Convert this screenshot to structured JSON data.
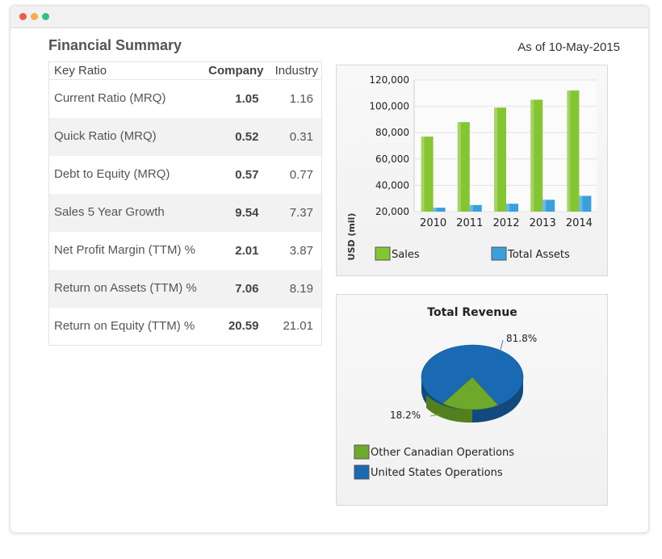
{
  "window": {
    "controls": [
      {
        "name": "close",
        "color": "#ee5a4a"
      },
      {
        "name": "minimize",
        "color": "#f4b03f"
      },
      {
        "name": "maximize",
        "color": "#2fc282"
      }
    ]
  },
  "summary": {
    "title": "Financial Summary",
    "as_of": "As of 10-May-2015"
  },
  "ratios": {
    "headers": {
      "key_ratio": "Key Ratio",
      "company": "Company",
      "industry": "Industry"
    },
    "rows": [
      {
        "name": "Current Ratio (MRQ)",
        "company": "1.05",
        "industry": "1.16"
      },
      {
        "name": "Quick Ratio (MRQ)",
        "company": "0.52",
        "industry": "0.31"
      },
      {
        "name": "Debt to Equity (MRQ)",
        "company": "0.57",
        "industry": "0.77"
      },
      {
        "name": "Sales 5 Year Growth",
        "company": "9.54",
        "industry": "7.37"
      },
      {
        "name": "Net Profit Margin (TTM) %",
        "company": "2.01",
        "industry": "3.87"
      },
      {
        "name": "Return on Assets (TTM) %",
        "company": "7.06",
        "industry": "8.19"
      },
      {
        "name": "Return on Equity (TTM) %",
        "company": "20.59",
        "industry": "21.01"
      }
    ]
  },
  "chart_data": [
    {
      "type": "bar",
      "title": "",
      "xlabel": "",
      "ylabel": "USD (mil)",
      "categories": [
        "2010",
        "2011",
        "2012",
        "2013",
        "2014"
      ],
      "ylim": [
        20000,
        120000
      ],
      "yticks": [
        "20,000",
        "40,000",
        "60,000",
        "80,000",
        "100,000",
        "120,000"
      ],
      "grid": true,
      "legend": "bottom",
      "series": [
        {
          "name": "Sales",
          "color": "#84c631",
          "values": [
            77000,
            88000,
            99000,
            105000,
            112000
          ]
        },
        {
          "name": "Total Assets",
          "color": "#3aa0dc",
          "values": [
            23000,
            25000,
            26000,
            29000,
            32000
          ]
        }
      ]
    },
    {
      "type": "pie",
      "title": "Total Revenue",
      "legend": "bottom",
      "slices": [
        {
          "name": "Other Canadian Operations",
          "value": 18.2,
          "label": "18.2%",
          "color": "#6fa92b"
        },
        {
          "name": "United States Operations",
          "value": 81.8,
          "label": "81.8%",
          "color": "#1969b3"
        }
      ]
    }
  ]
}
